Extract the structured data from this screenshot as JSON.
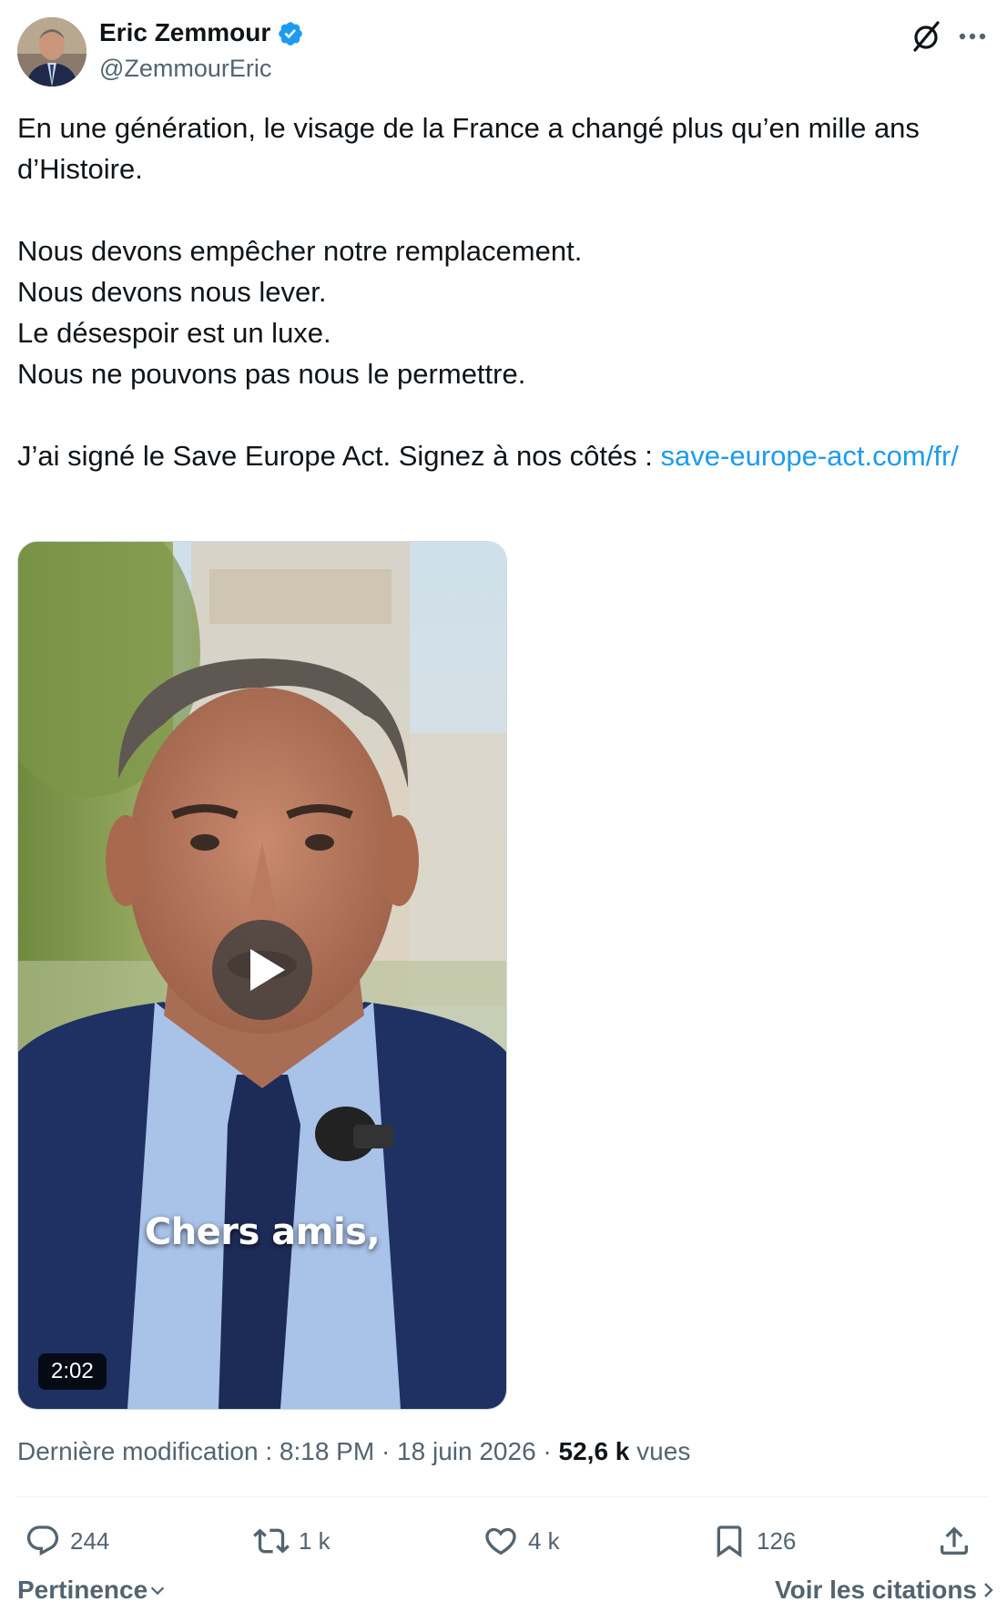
{
  "author": {
    "name": "Eric Zemmour",
    "handle": "@ZemmourEric",
    "verified": true,
    "avatar_icon": "avatar-photo"
  },
  "header_actions": {
    "grok_icon": "grok-icon",
    "more_icon": "more-dots-icon"
  },
  "tweet": {
    "line1": "En une génération, le visage de la France a changé plus qu’en mille ans d’Histoire.",
    "line2": "Nous devons empêcher notre remplacement.",
    "line3": "Nous devons nous lever.",
    "line4": "Le désespoir est un luxe.",
    "line5": "Nous ne pouvons pas nous le permettre.",
    "line6_prefix": "J’ai signé le Save Europe Act. Signez à nos côtés : ",
    "link": "save-europe-act.com/fr/"
  },
  "video": {
    "caption": "Chers amis,",
    "duration": "2:02"
  },
  "meta": {
    "edited_label": "Dernière modification : 8:18 PM · 18 juin 2026 · ",
    "views_count": "52,6 k",
    "views_label": "vues"
  },
  "actions": {
    "replies": "244",
    "reposts": "1 k",
    "likes": "4 k",
    "bookmarks": "126"
  },
  "footer": {
    "sort_label": "Pertinence",
    "quotes_label": "Voir les citations"
  },
  "colors": {
    "link": "#1d9bf0",
    "verified": "#1d9bf0",
    "secondary_text": "#536471",
    "primary_text": "#0f1419"
  }
}
